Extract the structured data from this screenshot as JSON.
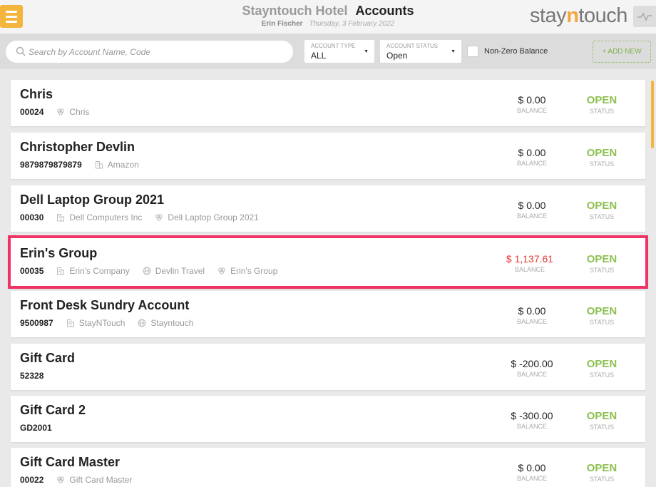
{
  "header": {
    "hotel_name": "Stayntouch Hotel",
    "page_title": "Accounts",
    "user_name": "Erin Fischer",
    "date": "Thursday, 3 February 2022",
    "menu_icon": "hamburger-icon",
    "logo_text": {
      "part1": "stay",
      "part2": "n",
      "part3": "touch"
    },
    "accent_color": "#f3b53b"
  },
  "toolbar": {
    "search_placeholder": "Search by Account Name, Code",
    "account_type": {
      "label": "ACCOUNT TYPE",
      "value": "ALL"
    },
    "account_status": {
      "label": "ACCOUNT STATUS",
      "value": "Open"
    },
    "non_zero_label": "Non-Zero Balance",
    "non_zero_checked": false,
    "add_new_label": "+ ADD NEW"
  },
  "colors": {
    "open": "#8cc04f",
    "negative_balance": "#e53935",
    "highlight": "#f03364"
  },
  "accounts": [
    {
      "name": "Chris",
      "code": "00024",
      "company": "",
      "travel_agent": "",
      "group": "Chris",
      "balance": "$ 0.00",
      "balance_label": "BALANCE",
      "status": "OPEN",
      "status_label": "STATUS"
    },
    {
      "name": "Christopher Devlin",
      "code": "9879879879879",
      "company": "Amazon",
      "travel_agent": "",
      "group": "",
      "balance": "$ 0.00",
      "balance_label": "BALANCE",
      "status": "OPEN",
      "status_label": "STATUS"
    },
    {
      "name": "Dell Laptop Group 2021",
      "code": "00030",
      "company": "Dell Computers Inc",
      "travel_agent": "",
      "group": "Dell Laptop Group 2021",
      "balance": "$ 0.00",
      "balance_label": "BALANCE",
      "status": "OPEN",
      "status_label": "STATUS"
    },
    {
      "name": "Erin's Group",
      "code": "00035",
      "company": "Erin's Company",
      "travel_agent": "Devlin Travel",
      "group": "Erin's Group",
      "balance": "$ 1,137.61",
      "balance_label": "BALANCE",
      "status": "OPEN",
      "status_label": "STATUS",
      "highlighted": true
    },
    {
      "name": "Front Desk Sundry Account",
      "code": "9500987",
      "company": "StayNTouch",
      "travel_agent": "Stayntouch",
      "group": "",
      "balance": "$ 0.00",
      "balance_label": "BALANCE",
      "status": "OPEN",
      "status_label": "STATUS"
    },
    {
      "name": "Gift Card",
      "code": "52328",
      "company": "",
      "travel_agent": "",
      "group": "",
      "balance": "$ -200.00",
      "balance_label": "BALANCE",
      "status": "OPEN",
      "status_label": "STATUS"
    },
    {
      "name": "Gift Card 2",
      "code": "GD2001",
      "company": "",
      "travel_agent": "",
      "group": "",
      "balance": "$ -300.00",
      "balance_label": "BALANCE",
      "status": "OPEN",
      "status_label": "STATUS"
    },
    {
      "name": "Gift Card Master",
      "code": "00022",
      "company": "",
      "travel_agent": "",
      "group": "Gift Card Master",
      "balance": "$ 0.00",
      "balance_label": "BALANCE",
      "status": "OPEN",
      "status_label": "STATUS"
    }
  ]
}
